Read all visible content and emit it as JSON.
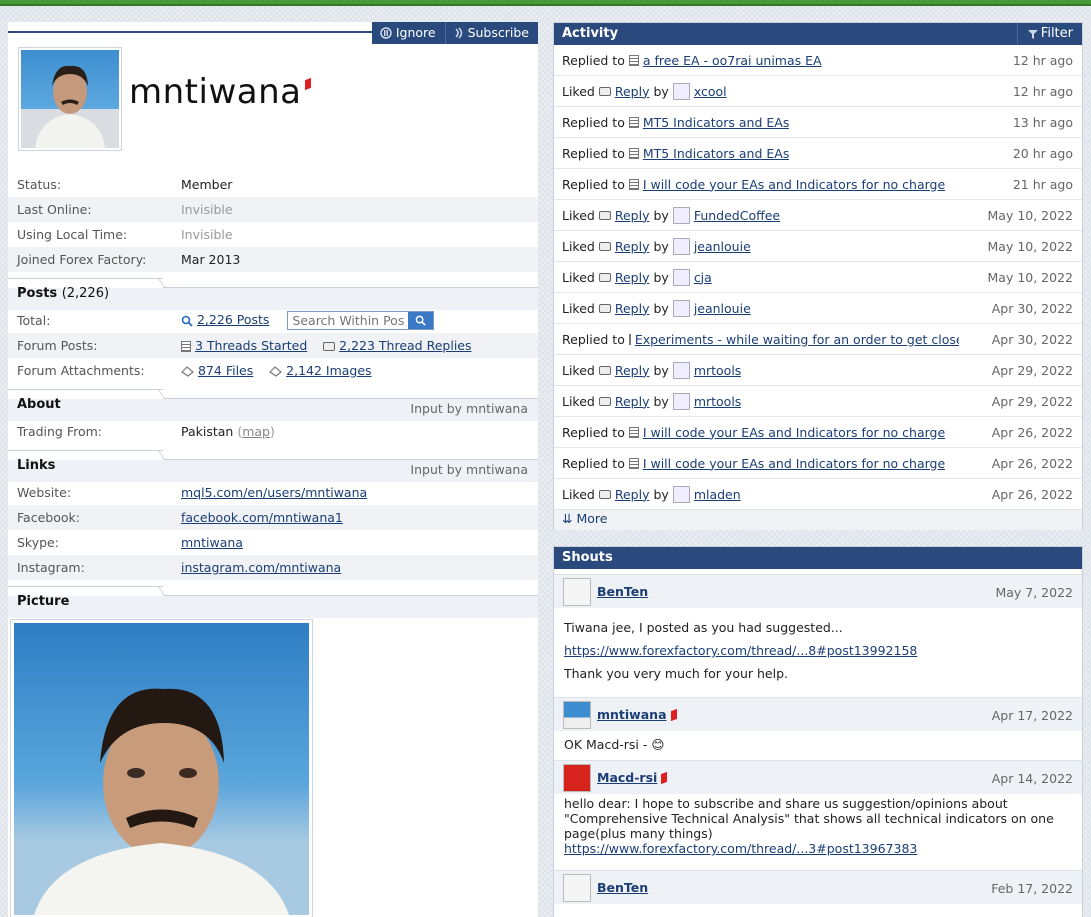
{
  "header": {
    "ignore_label": "Ignore",
    "subscribe_label": "Subscribe"
  },
  "profile": {
    "username": "mntiwana",
    "fields": [
      {
        "key": "Status:",
        "value": "Member"
      },
      {
        "key": "Last Online:",
        "value": "Invisible"
      },
      {
        "key": "Using Local Time:",
        "value": "Invisible"
      },
      {
        "key": "Joined Forex Factory:",
        "value": "Mar 2013"
      }
    ]
  },
  "posts": {
    "title": "Posts",
    "count": "(2,226)",
    "total_label": "Total:",
    "total_value": "2,226 Posts",
    "search_placeholder": "Search Within Posts",
    "forum_posts_label": "Forum Posts:",
    "threads_started": "3 Threads Started",
    "thread_replies": "2,223 Thread Replies",
    "attachments_label": "Forum Attachments:",
    "files": "874 Files",
    "images": "2,142 Images"
  },
  "about": {
    "title": "About",
    "input_by": "Input by mntiwana",
    "trading_from_label": "Trading From:",
    "trading_from_value": "Pakistan",
    "map_label": "map"
  },
  "links": {
    "title": "Links",
    "input_by": "Input by mntiwana",
    "items": [
      {
        "key": "Website:",
        "value": "mql5.com/en/users/mntiwana"
      },
      {
        "key": "Facebook:",
        "value": "facebook.com/mntiwana1"
      },
      {
        "key": "Skype:",
        "value": "mntiwana"
      },
      {
        "key": "Instagram:",
        "value": "instagram.com/mntiwana"
      }
    ]
  },
  "picture": {
    "title": "Picture"
  },
  "activity": {
    "title": "Activity",
    "filter_label": "Filter",
    "more_label": "More",
    "rows": [
      {
        "verb": "Replied to",
        "target": "a free EA - oo7rai unimas EA",
        "time": "12 hr ago"
      },
      {
        "verb": "Liked",
        "target": "Reply",
        "by": "xcool",
        "time": "12 hr ago"
      },
      {
        "verb": "Replied to",
        "target": "MT5 Indicators and EAs",
        "time": "13 hr ago"
      },
      {
        "verb": "Replied to",
        "target": "MT5 Indicators and EAs",
        "time": "20 hr ago"
      },
      {
        "verb": "Replied to",
        "target": "I will code your EAs and Indicators for no charge",
        "time": "21 hr ago"
      },
      {
        "verb": "Liked",
        "target": "Reply",
        "by": "FundedCoffee",
        "time": "May 10, 2022"
      },
      {
        "verb": "Liked",
        "target": "Reply",
        "by": "jeanlouie",
        "time": "May 10, 2022"
      },
      {
        "verb": "Liked",
        "target": "Reply",
        "by": "cja",
        "time": "May 10, 2022"
      },
      {
        "verb": "Liked",
        "target": "Reply",
        "by": "jeanlouie",
        "time": "Apr 30, 2022"
      },
      {
        "verb": "Replied to",
        "target": "Experiments - while waiting for an order to get closed",
        "time": "Apr 30, 2022"
      },
      {
        "verb": "Liked",
        "target": "Reply",
        "by": "mrtools",
        "time": "Apr 29, 2022"
      },
      {
        "verb": "Liked",
        "target": "Reply",
        "by": "mrtools",
        "time": "Apr 29, 2022"
      },
      {
        "verb": "Replied to",
        "target": "I will code your EAs and Indicators for no charge",
        "time": "Apr 26, 2022"
      },
      {
        "verb": "Replied to",
        "target": "I will code your EAs and Indicators for no charge",
        "time": "Apr 26, 2022"
      },
      {
        "verb": "Liked",
        "target": "Reply",
        "by": "mladen",
        "time": "Apr 26, 2022"
      }
    ],
    "by_word": "by"
  },
  "shouts": {
    "title": "Shouts",
    "items": [
      {
        "name": "BenTen",
        "date": "May 7, 2022",
        "line1": "Tiwana jee, I posted as you had suggested...",
        "link": "https://www.forexfactory.com/thread/...8#post13992158",
        "line2": "Thank you very much for your help."
      },
      {
        "name": "mntiwana",
        "date": "Apr 17, 2022",
        "line1": "OK Macd-rsi - 😊"
      },
      {
        "name": "Macd-rsi",
        "date": "Apr 14, 2022",
        "line1": "hello dear: I hope to subscribe and share us suggestion/opinions about \"Comprehensive Technical Analysis\" that shows all technical indicators on one page(plus many things)",
        "link": "https://www.forexfactory.com/thread/...3#post13967383"
      },
      {
        "name": "BenTen",
        "date": "Feb 17, 2022"
      }
    ]
  }
}
